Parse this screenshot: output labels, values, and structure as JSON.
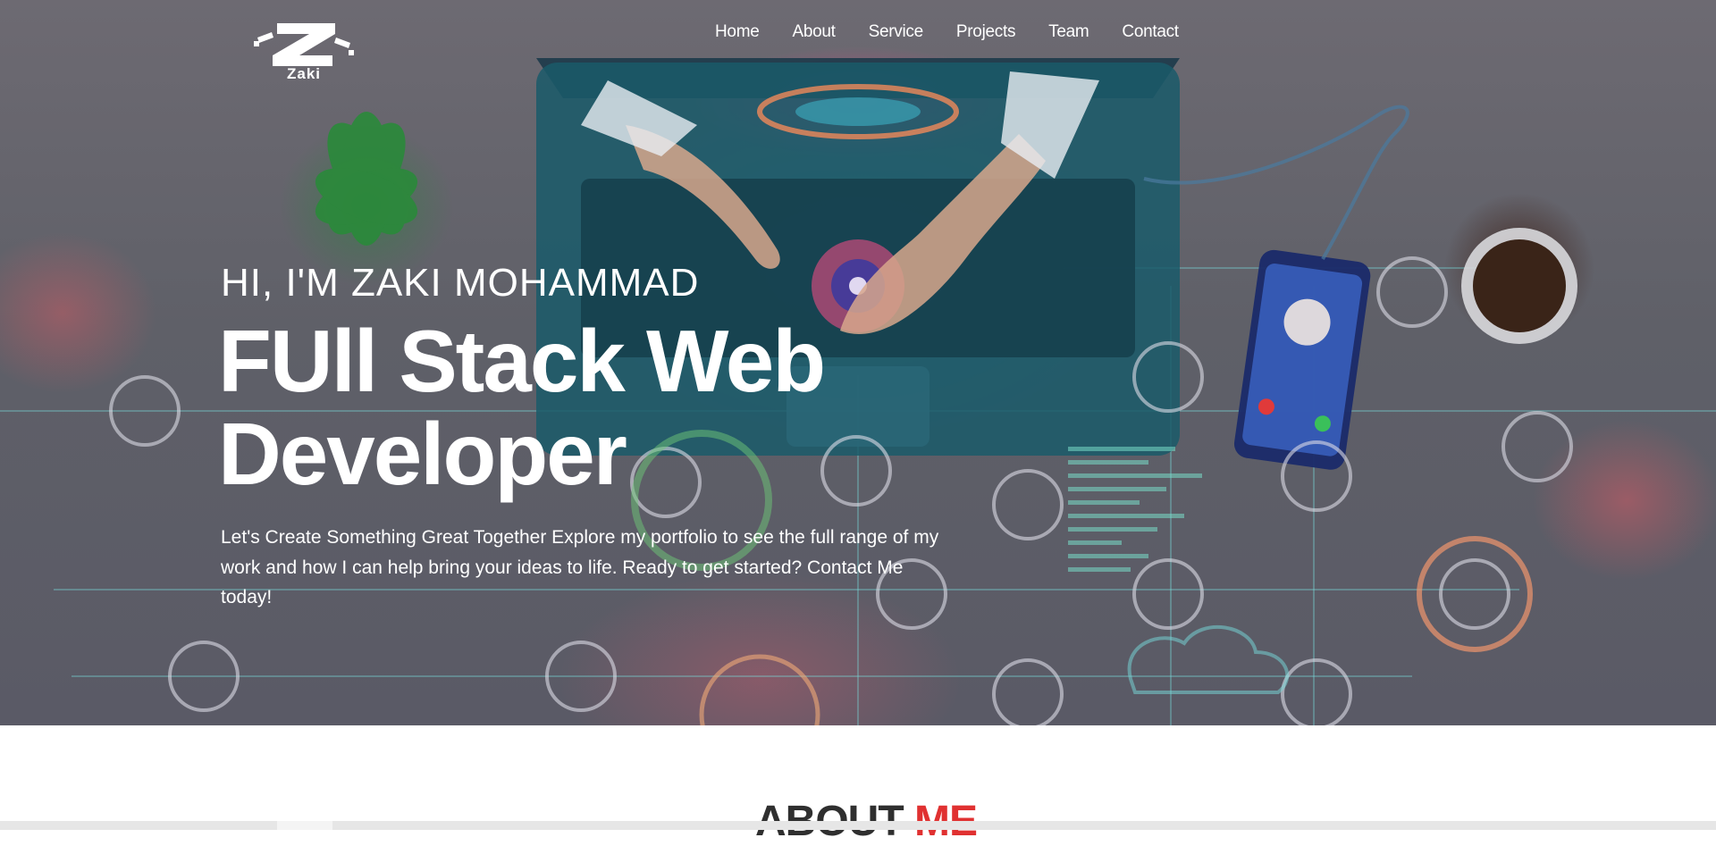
{
  "logo": {
    "text": "Zaki",
    "icon": "zaki-logo"
  },
  "nav": {
    "items": [
      {
        "label": "Home"
      },
      {
        "label": "About"
      },
      {
        "label": "Service"
      },
      {
        "label": "Projects"
      },
      {
        "label": "Team"
      },
      {
        "label": "Contact"
      }
    ]
  },
  "hero": {
    "subtitle": "HI, I'M ZAKI MOHAMMAD",
    "title": "FUll Stack Web Developer",
    "description": "Let's Create Something Great Together Explore my portfolio to see the full range of my work and how I can help bring your ideas to life. Ready to get started? Contact Me today!"
  },
  "about": {
    "heading_main": "ABOUT",
    "heading_accent": "ME"
  },
  "colors": {
    "accent": "#e03131",
    "hero_text": "#ffffff"
  }
}
